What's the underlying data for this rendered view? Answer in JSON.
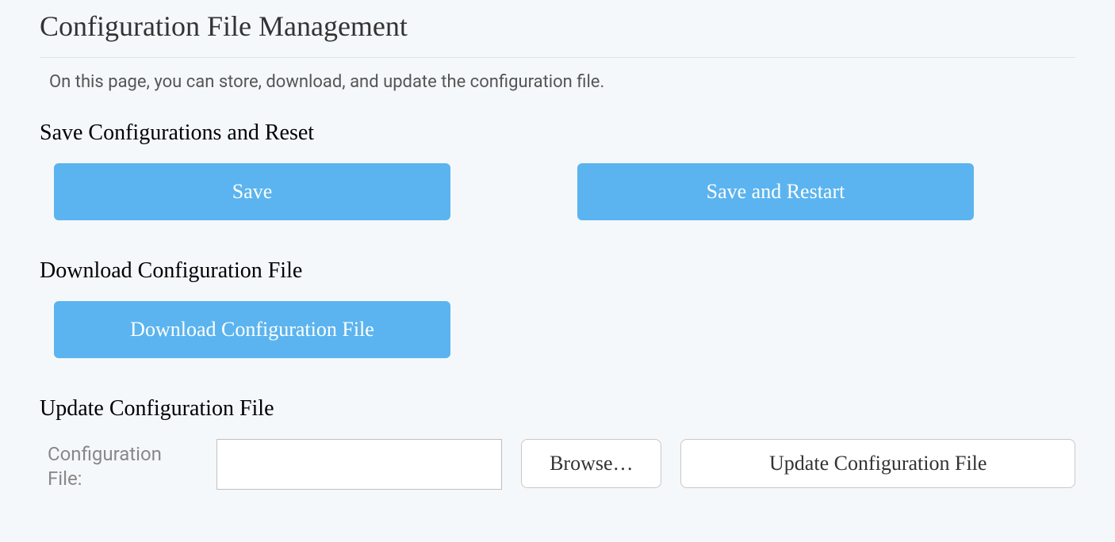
{
  "page": {
    "title": "Configuration File Management",
    "description": "On this page, you can store, download, and update the configuration file."
  },
  "sections": {
    "save": {
      "heading": "Save Configurations and Reset",
      "save_label": "Save",
      "save_restart_label": "Save and Restart"
    },
    "download": {
      "heading": "Download Configuration File",
      "download_label": "Download Configuration File"
    },
    "update": {
      "heading": "Update Configuration File",
      "file_label": "Configuration File:",
      "file_value": "",
      "browse_label": "Browse…",
      "update_label": "Update Configuration File"
    }
  }
}
